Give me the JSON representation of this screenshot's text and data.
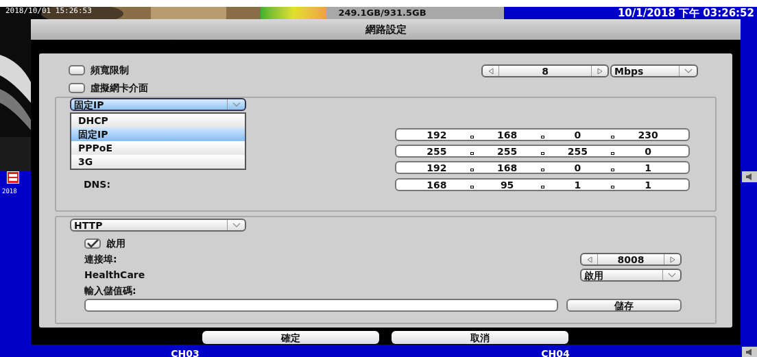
{
  "overlay": {
    "camera_time": "2018/10/01 15:26:53",
    "storage": {
      "text": "249.1GB/931.5GB",
      "level": 0.27
    },
    "clock": "10/1/2018 下午 03:26:52",
    "side_date": "2018",
    "channels": [
      "CH03",
      "CH04"
    ]
  },
  "dialog": {
    "title": "網路設定",
    "options": [
      {
        "label": "頻寬限制",
        "checked": false
      },
      {
        "label": "虛擬網卡介面",
        "checked": false
      }
    ],
    "bandwidth": {
      "value": "8",
      "unit": "Mbps"
    },
    "ip_mode": {
      "value": "固定IP",
      "expanded": true,
      "items": [
        {
          "label": "DHCP",
          "selected": false
        },
        {
          "label": "固定IP",
          "selected": true
        },
        {
          "label": "PPPoE",
          "selected": false
        },
        {
          "label": "3G",
          "selected": false
        }
      ]
    },
    "addresses": [
      {
        "octets": [
          "192",
          "168",
          "0",
          "230"
        ]
      },
      {
        "octets": [
          "255",
          "255",
          "255",
          "0"
        ]
      },
      {
        "octets": [
          "192",
          "168",
          "0",
          "1"
        ]
      },
      {
        "label": "DNS:",
        "octets": [
          "168",
          "95",
          "1",
          "1"
        ]
      }
    ],
    "service": {
      "value": "HTTP",
      "expanded": false
    },
    "enable": {
      "label": "啟用",
      "checked": true
    },
    "port": {
      "label": "連接埠:",
      "value": "8008"
    },
    "healthcare": {
      "label": "HealthCare",
      "value": "啟用"
    },
    "code": {
      "label": "輸入儲值碼:",
      "save": "儲存"
    },
    "buttons": [
      "確定",
      "取消"
    ]
  }
}
